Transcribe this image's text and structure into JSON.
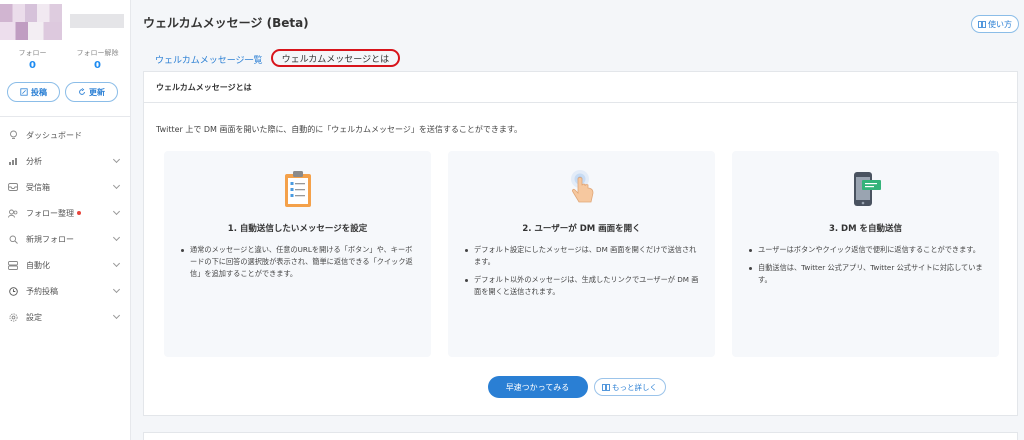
{
  "sidebar": {
    "stats": [
      {
        "label": "フォロー",
        "value": "0"
      },
      {
        "label": "フォロー解除",
        "value": "0"
      }
    ],
    "buttons": {
      "post": "投稿",
      "refresh": "更新"
    },
    "nav": [
      {
        "label": "ダッシュボード",
        "icon": "bulb-icon",
        "chevron": false,
        "dot": false
      },
      {
        "label": "分析",
        "icon": "bar-chart-icon",
        "chevron": true,
        "dot": false
      },
      {
        "label": "受信箱",
        "icon": "inbox-icon",
        "chevron": true,
        "dot": false
      },
      {
        "label": "フォロー整理",
        "icon": "users-icon",
        "chevron": true,
        "dot": true
      },
      {
        "label": "新規フォロー",
        "icon": "search-icon",
        "chevron": true,
        "dot": false
      },
      {
        "label": "自動化",
        "icon": "stack-icon",
        "chevron": true,
        "dot": false
      },
      {
        "label": "予約投稿",
        "icon": "clock-icon",
        "chevron": true,
        "dot": false
      },
      {
        "label": "設定",
        "icon": "gear-icon",
        "chevron": true,
        "dot": false
      }
    ]
  },
  "header": {
    "title": "ウェルカムメッセージ (Beta)",
    "howto": "使い方"
  },
  "tabs": [
    {
      "label": "ウェルカムメッセージ一覧",
      "active": false
    },
    {
      "label": "ウェルカムメッセージとは",
      "active": true
    }
  ],
  "card": {
    "heading": "ウェルカムメッセージとは",
    "intro": "Twitter 上で DM 画面を開いた際に、自動的に「ウェルカムメッセージ」を送信することができます。",
    "features": [
      {
        "title": "1. 自動送信したいメッセージを設定",
        "icon": "clipboard-icon",
        "bullets": [
          "通常のメッセージと違い、任意のURLを開ける「ボタン」や、キーボードの下に回答の選択肢が表示され、簡単に返信できる「クイック返信」を追加することができます。"
        ]
      },
      {
        "title": "2. ユーザーが DM 画面を開く",
        "icon": "tap-icon",
        "bullets": [
          "デフォルト設定にしたメッセージは、DM 画面を開くだけで送信されます。",
          "デフォルト以外のメッセージは、生成したリンクでユーザーが DM 画面を開くと送信されます。"
        ]
      },
      {
        "title": "3. DM を自動送信",
        "icon": "phone-message-icon",
        "bullets": [
          "ユーザーはボタンやクイック返信で便利に返信することができます。",
          "自動送信は、Twitter 公式アプリ、Twitter 公式サイトに対応しています。"
        ]
      }
    ],
    "cta": "早速つかってみる",
    "more": "もっと詳しく"
  },
  "colors": {
    "accent": "#2a7fd4",
    "highlight_ring": "#d8141b"
  }
}
